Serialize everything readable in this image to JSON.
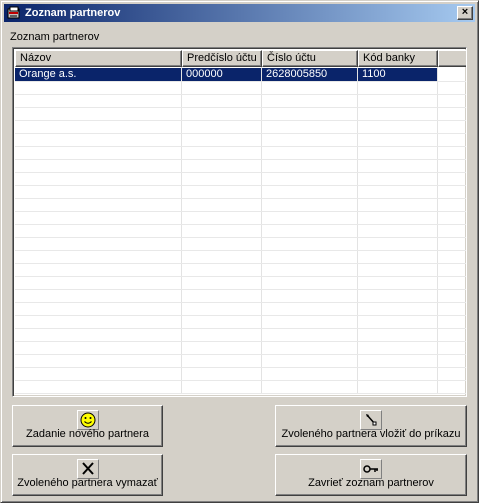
{
  "window": {
    "title": "Zoznam partnerov",
    "close_label": "×"
  },
  "group_label": "Zoznam partnerov",
  "table": {
    "columns": [
      "Názov",
      "Predčíslo účtu",
      "Číslo účtu",
      "Kód banky"
    ],
    "rows": [
      [
        "Orange a.s.",
        "000000",
        "2628005850",
        "1100"
      ]
    ],
    "selected_row": 0
  },
  "buttons": {
    "add": {
      "label": "Zadanie nového partnera",
      "icon": "smiley-icon"
    },
    "insert": {
      "label": "Zvoleného partnera vložiť do príkazu",
      "icon": "pen-icon"
    },
    "delete": {
      "label": "Zvoleného partnera vymazať",
      "icon": "x-icon"
    },
    "close": {
      "label": "Zavrieť zoznam partnerov",
      "icon": "key-icon"
    }
  },
  "colors": {
    "title_gradient_start": "#0a246a",
    "title_gradient_end": "#a6caf0",
    "selection": "#0a246a",
    "face": "#d4d0c8",
    "smiley": "#ffff00"
  }
}
